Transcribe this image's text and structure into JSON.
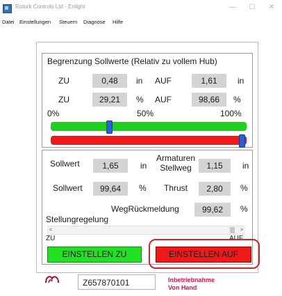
{
  "window": {
    "title": "Rotork Controls Ltd - Enlight",
    "minimize_glyph": "—",
    "maximize_glyph": "☐",
    "close_glyph": "✕"
  },
  "menu": [
    "Datei",
    "Einstellungen",
    "Steuern",
    "Diagnose",
    "Hilfe"
  ],
  "limits": {
    "heading": "Begrenzung Sollwerte (Relativ zu vollem Hub)",
    "row1": {
      "zu_label": "ZU",
      "zu_value": "0,48",
      "zu_unit": "in",
      "auf_label": "AUF",
      "auf_value": "1,61",
      "auf_unit": "in"
    },
    "row2": {
      "zu_label": "ZU",
      "zu_value": "29,21",
      "zu_unit": "%",
      "auf_label": "AUF",
      "auf_value": "98,66",
      "auf_unit": "%"
    },
    "scale": [
      "0%",
      "50%",
      "100%"
    ],
    "zu_slider_percent": 29.21,
    "auf_slider_percent": 98.66
  },
  "position": {
    "sollwert_label": "Sollwert",
    "sollwert_in": "1,65",
    "sollwert_in_unit": "in",
    "armaturen_stellweg_label_line1": "Armaturen",
    "armaturen_stellweg_label_line2": "Stellweg",
    "stellweg_in": "1,15",
    "stellweg_in_unit": "in",
    "sollwert2_label": "Sollwert",
    "sollwert_pct": "99,64",
    "sollwert_pct_unit": "%",
    "thrust_label": "Thrust",
    "thrust_value": "2,80",
    "thrust_unit": "%",
    "wegrueckmeldung_label": "WegRückmeldung",
    "wegrueckmeldung_value": "99,62",
    "wegrueckmeldung_unit": "%",
    "stellungregelung_label": "Stellungregelung",
    "scroll_left": "<",
    "scroll_right": ">",
    "zu_label": "ZU",
    "auf_label": "AUF",
    "scrollbar_percent": 98
  },
  "buttons": {
    "einstellen_zu": "EINSTELLEN ZU",
    "einstellen_auf": "EINSTELLEN AUF"
  },
  "footer": {
    "device_id": "Z657870101",
    "status_line1": "Inbetriebnahme",
    "status_line2": "Von Hand"
  },
  "colors": {
    "green": "#22e022",
    "red": "#ee1a1a",
    "slider_thumb": "#2a5fd8",
    "status_text": "#d01a50",
    "highlight_ring": "#d8202a"
  },
  "icons": {
    "app": "app-icon",
    "logo": "rotork-logo-icon"
  }
}
